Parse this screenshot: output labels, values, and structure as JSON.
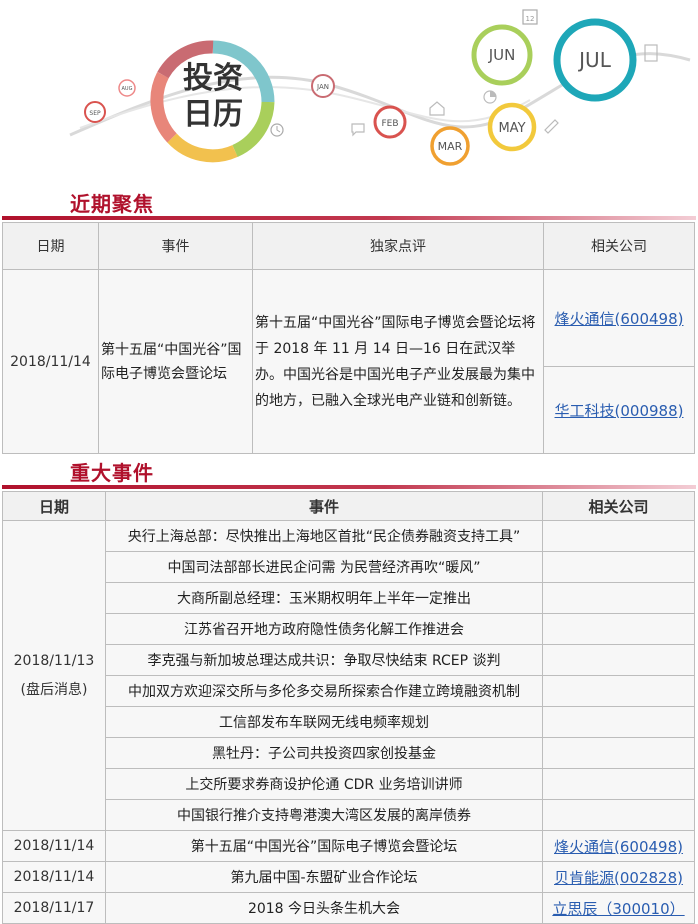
{
  "banner": {
    "logo_line1": "投资",
    "logo_line2": "日历",
    "months": [
      "SEP",
      "AUG",
      "JAN",
      "FEB",
      "MAR",
      "MAY",
      "JUN",
      "JUL"
    ],
    "calendar_icon_text": "12"
  },
  "focus": {
    "title": "近期聚焦",
    "headers": [
      "日期",
      "事件",
      "独家点评",
      "相关公司"
    ],
    "row": {
      "date": "2018/11/14",
      "event": "第十五届“中国光谷”国际电子博览会暨论坛",
      "comment": "第十五届“中国光谷”国际电子博览会暨论坛将于 2018 年 11 月 14 日—16 日在武汉举办。中国光谷是中国光电子产业发展最为集中的地方，已融入全球光电产业链和创新链。",
      "companies": [
        "烽火通信(600498)",
        "华工科技(000988)"
      ]
    }
  },
  "major": {
    "title": "重大事件",
    "headers": [
      "日期",
      "事件",
      "相关公司"
    ],
    "group": {
      "date": "2018/11/13",
      "note": "(盘后消息)",
      "events": [
        "央行上海总部：尽快推出上海地区首批“民企债券融资支持工具”",
        "中国司法部部长进民企问需 为民营经济再吹“暖风”",
        "大商所副总经理：玉米期权明年上半年一定推出",
        "江苏省召开地方政府隐性债务化解工作推进会",
        "李克强与新加坡总理达成共识：争取尽快结束 RCEP 谈判",
        "中加双方欢迎深交所与多伦多交易所探索合作建立跨境融资机制",
        "工信部发布车联网无线电频率规划",
        "黑牡丹：子公司共投资四家创投基金",
        "上交所要求券商设护伦通 CDR 业务培训讲师",
        "中国银行推介支持粤港澳大湾区发展的离岸债券"
      ]
    },
    "rows": [
      {
        "date": "2018/11/14",
        "event": "第十五届“中国光谷”国际电子博览会暨论坛",
        "company": "烽火通信(600498)"
      },
      {
        "date": "2018/11/14",
        "event": "第九届中国-东盟矿业合作论坛",
        "company": "贝肯能源(002828)"
      },
      {
        "date": "2018/11/17",
        "event": "2018 今日头条生机大会",
        "company": "立思辰（300010）"
      }
    ]
  }
}
